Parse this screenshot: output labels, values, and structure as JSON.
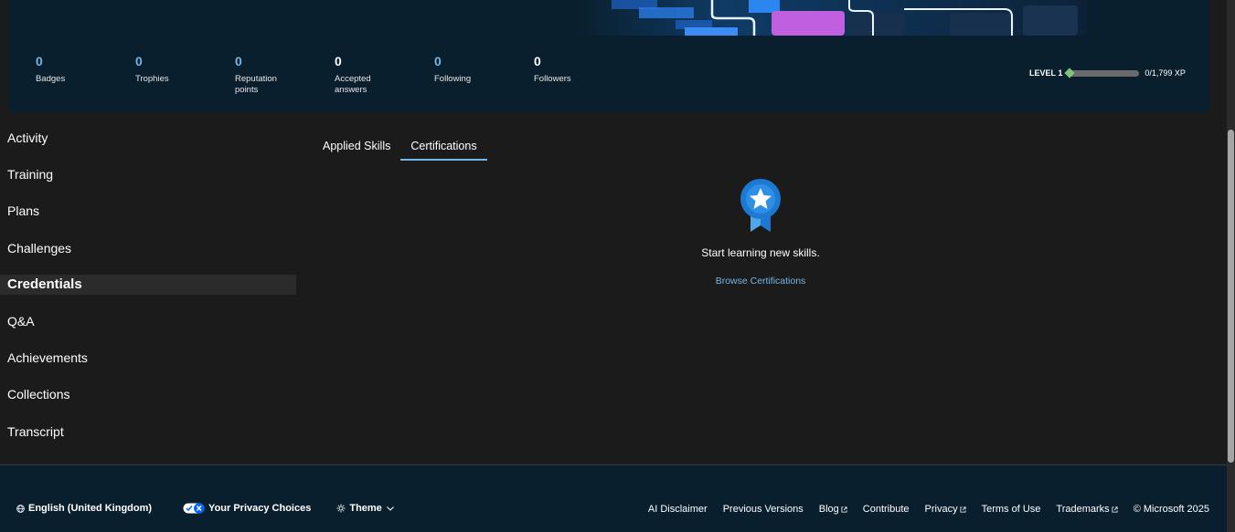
{
  "stats": [
    {
      "value": "0",
      "label": "Badges"
    },
    {
      "value": "0",
      "label": "Trophies"
    },
    {
      "value": "0",
      "label": "Reputation points"
    },
    {
      "value": "0",
      "label": "Accepted answers"
    },
    {
      "value": "0",
      "label": "Following"
    },
    {
      "value": "0",
      "label": "Followers"
    }
  ],
  "level": {
    "label": "LEVEL 1",
    "xp_text": "0/1,799 XP",
    "progress": 0
  },
  "sidebar": {
    "items": [
      {
        "label": "Activity"
      },
      {
        "label": "Training"
      },
      {
        "label": "Plans"
      },
      {
        "label": "Challenges"
      },
      {
        "label": "Credentials"
      },
      {
        "label": "Q&A"
      },
      {
        "label": "Achievements"
      },
      {
        "label": "Collections"
      },
      {
        "label": "Transcript"
      }
    ],
    "active": "Credentials"
  },
  "tabs": [
    {
      "label": "Applied Skills"
    },
    {
      "label": "Certifications"
    }
  ],
  "active_tab": "Certifications",
  "empty_state": {
    "message": "Start learning new skills.",
    "link": "Browse Certifications"
  },
  "footer": {
    "language": "English (United Kingdom)",
    "privacy_choices": "Your Privacy Choices",
    "theme": "Theme",
    "links": [
      "AI Disclaimer",
      "Previous Versions",
      "Blog",
      "Contribute",
      "Privacy",
      "Terms of Use",
      "Trademarks"
    ],
    "copyright": "© Microsoft 2025"
  },
  "colors": {
    "accent": "#75b6e7",
    "page_bg": "#1b1b1b",
    "header_bg": "#0a1f2d",
    "xp_green": "#7fc37a"
  }
}
